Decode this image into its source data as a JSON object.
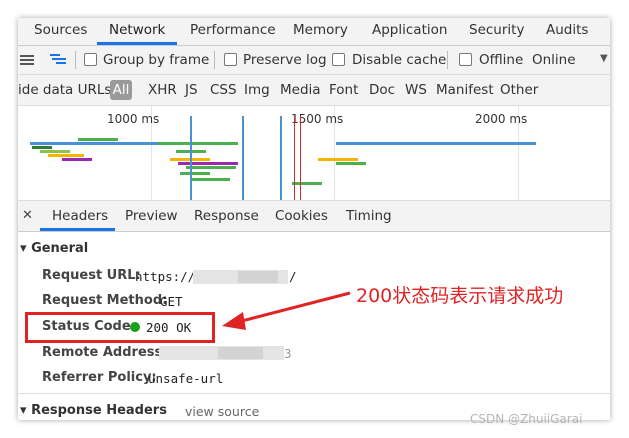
{
  "tabs": [
    "Sources",
    "Network",
    "Performance",
    "Memory",
    "Application",
    "Security",
    "Audits"
  ],
  "toolbar": {
    "group_by_frame": "Group by frame",
    "preserve_log": "Preserve log",
    "disable_cache": "Disable cache",
    "offline": "Offline",
    "throttle": "Online"
  },
  "filters": {
    "hide_data_urls": "ide data URLs",
    "all": "All",
    "types": [
      "XHR",
      "JS",
      "CSS",
      "Img",
      "Media",
      "Font",
      "Doc",
      "WS",
      "Manifest",
      "Other"
    ]
  },
  "timeline": {
    "ticks": [
      "1000 ms",
      "1500 ms",
      "2000 ms"
    ]
  },
  "detail_tabs": [
    "Headers",
    "Preview",
    "Response",
    "Cookies",
    "Timing"
  ],
  "general": {
    "title": "General",
    "request_url_label": "Request URL:",
    "request_url_prefix": "https://",
    "request_url_suffix": "/",
    "request_method_label": "Request Method:",
    "request_method_value": "GET",
    "status_code_label": "Status Code:",
    "status_code_value": "200 OK",
    "remote_address_label": "Remote Address:",
    "remote_address_suffix": "3",
    "referrer_policy_label": "Referrer Policy:",
    "referrer_policy_value": "unsafe-url"
  },
  "response_headers": {
    "title": "Response Headers",
    "view_source": "view source"
  },
  "annotation": "200状态码表示请求成功",
  "watermark": "CSDN @ZhuiiGarai",
  "colors": {
    "accent": "#1a73e8",
    "status_ok": "#1aa11a",
    "annotation_red": "#e02424"
  }
}
